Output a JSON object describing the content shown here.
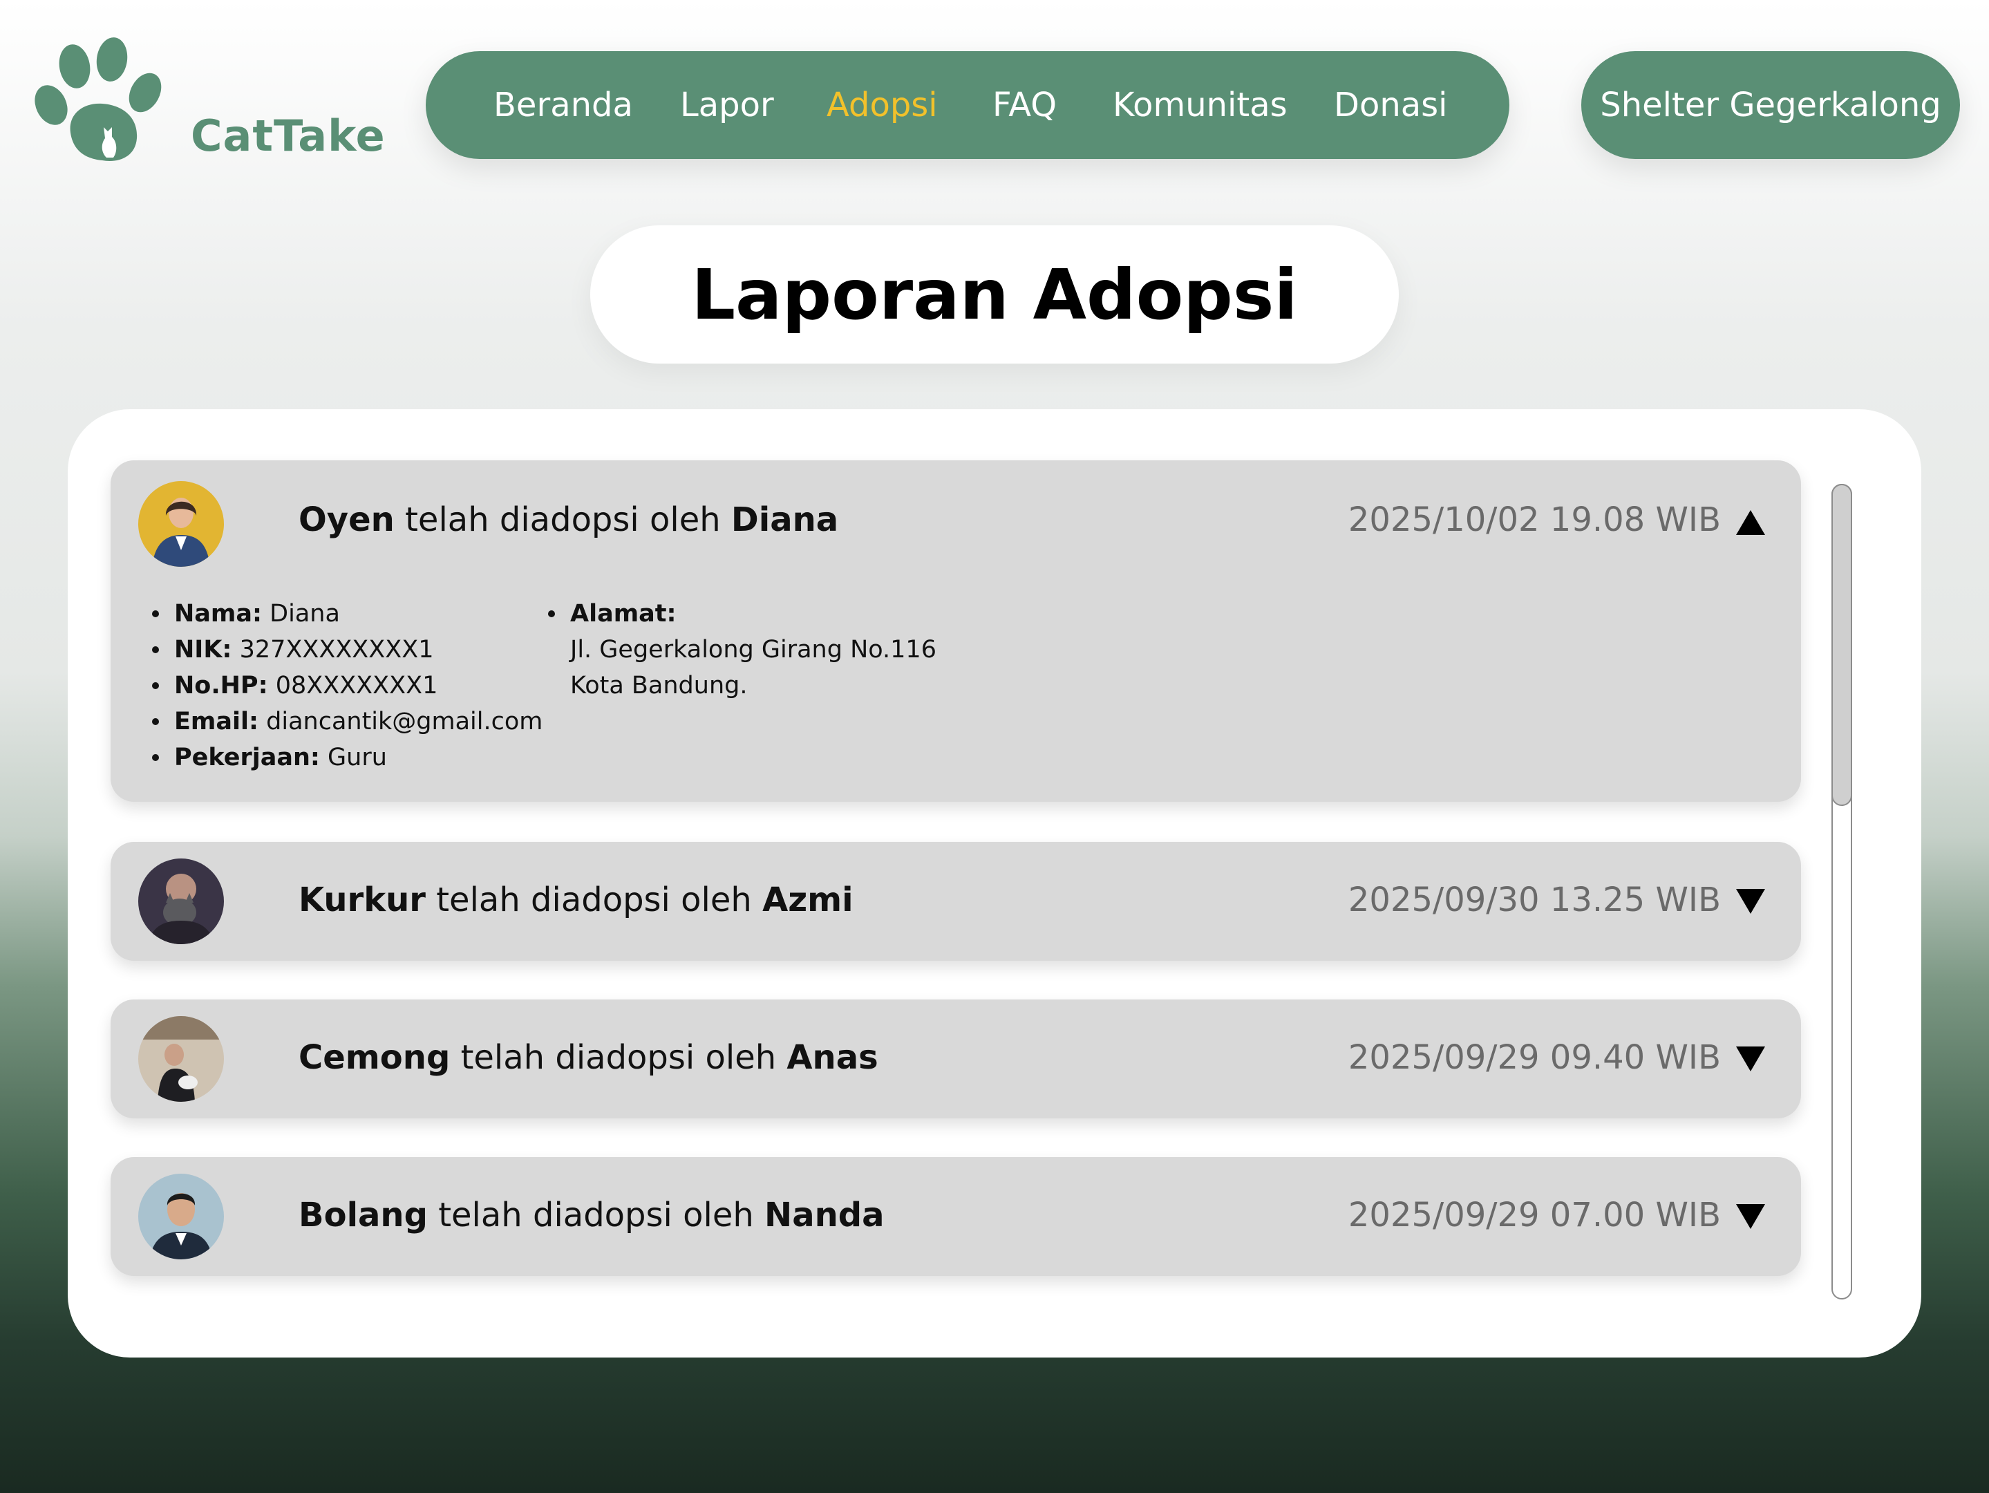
{
  "brand": {
    "name": "CatTake",
    "color": "#5a8f75",
    "logo_icon": "paw-cat-icon"
  },
  "nav": {
    "items": [
      {
        "label": "Beranda",
        "active": false
      },
      {
        "label": "Lapor",
        "active": false
      },
      {
        "label": "Adopsi",
        "active": true
      },
      {
        "label": "FAQ",
        "active": false
      },
      {
        "label": "Komunitas",
        "active": false
      },
      {
        "label": "Donasi",
        "active": false
      }
    ],
    "active_color": "#f2c12b"
  },
  "shelter_button": {
    "label": "Shelter Gegerkalong"
  },
  "page_title": "Laporan Adopsi",
  "entries": [
    {
      "cat": "Oyen",
      "connector": "telah diadopsi oleh",
      "adopter": "Diana",
      "timestamp": "2025/10/02 19.08 WIB",
      "expanded": true,
      "toggle_icon": "triangle-up-icon",
      "details": {
        "nama_label": "Nama:",
        "nama": "Diana",
        "nik_label": "NIK:",
        "nik": "327XXXXXXXX1",
        "hp_label": "No.HP:",
        "hp": "08XXXXXXX1",
        "email_label": "Email:",
        "email": "diancantik@gmail.com",
        "pekerjaan_label": "Pekerjaan:",
        "pekerjaan": "Guru",
        "alamat_label": "Alamat:",
        "alamat_line1": "Jl. Gegerkalong Girang No.116",
        "alamat_line2": "Kota Bandung."
      }
    },
    {
      "cat": "Kurkur",
      "connector": "telah diadopsi oleh",
      "adopter": "Azmi",
      "timestamp": "2025/09/30 13.25 WIB",
      "expanded": false,
      "toggle_icon": "triangle-down-icon"
    },
    {
      "cat": "Cemong",
      "connector": "telah diadopsi oleh",
      "adopter": "Anas",
      "timestamp": "2025/09/29 09.40 WIB",
      "expanded": false,
      "toggle_icon": "triangle-down-icon"
    },
    {
      "cat": "Bolang",
      "connector": "telah diadopsi oleh",
      "adopter": "Nanda",
      "timestamp": "2025/09/29 07.00 WIB",
      "expanded": false,
      "toggle_icon": "triangle-down-icon"
    }
  ]
}
